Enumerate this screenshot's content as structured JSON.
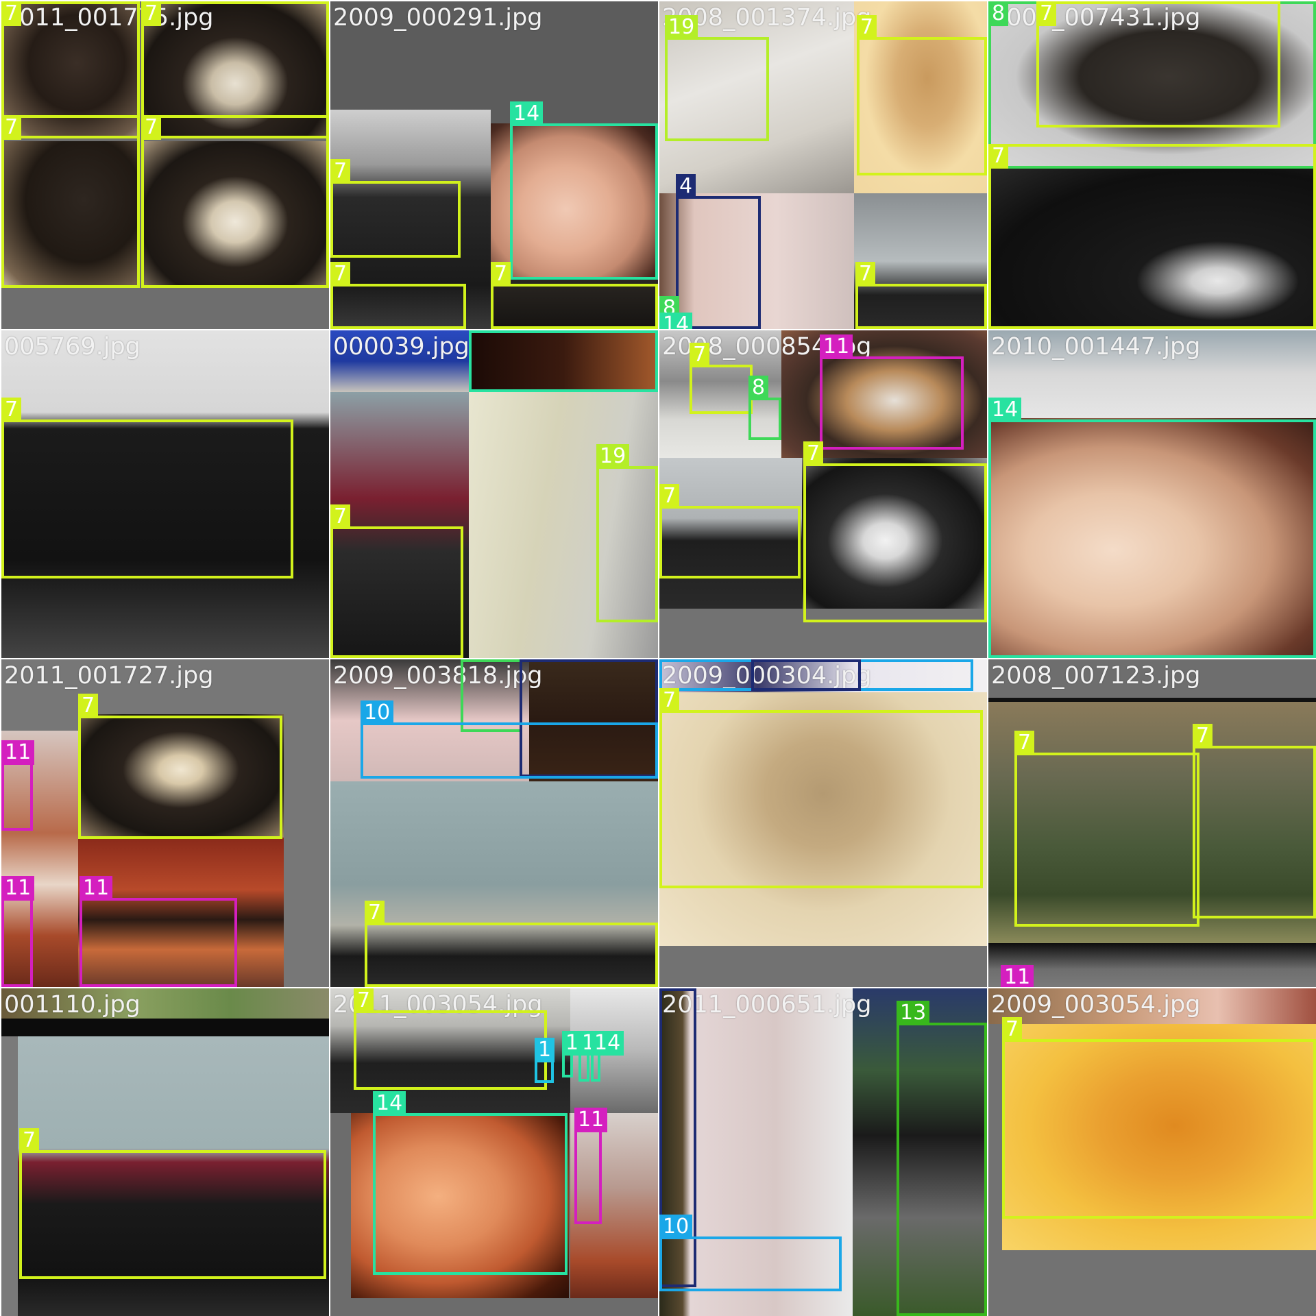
{
  "tiles": [
    {
      "id": "r0c0",
      "filename": "2011_001775.jpg"
    },
    {
      "id": "r0c1",
      "filename": "2009_000291.jpg"
    },
    {
      "id": "r0c2",
      "filename": "2008_001374.jpg"
    },
    {
      "id": "r0c3",
      "filename": "2007_007431.jpg"
    },
    {
      "id": "r1c0",
      "filename": "005769.jpg"
    },
    {
      "id": "r1c1",
      "filename": "000039.jpg"
    },
    {
      "id": "r1c2",
      "filename": "2008_000854.jpg"
    },
    {
      "id": "r1c3",
      "filename": "2010_001447.jpg"
    },
    {
      "id": "r2c0",
      "filename": "2011_001727.jpg"
    },
    {
      "id": "r2c1",
      "filename": "2009_003818.jpg"
    },
    {
      "id": "r2c2",
      "filename": "2009_000304.jpg"
    },
    {
      "id": "r2c3",
      "filename": "2008_007123.jpg"
    },
    {
      "id": "r3c0",
      "filename": "001110.jpg"
    },
    {
      "id": "r3c1",
      "filename": "2011_003054.jpg"
    },
    {
      "id": "r3c2",
      "filename": "2011_000651.jpg"
    },
    {
      "id": "r3c3",
      "filename": "2009_003054.jpg"
    }
  ],
  "class_colors": {
    "1": "#1fc3e3",
    "4": "#1d2b73",
    "7": "#d2f21c",
    "8": "#3ed858",
    "10": "#1aa7e8",
    "11": "#d41fbf",
    "13": "#38b81c",
    "14": "#27e2a0",
    "19": "#b4ee28"
  },
  "detections": {
    "r0c0": [
      "7",
      "7",
      "7",
      "7"
    ],
    "r0c1": [
      "7",
      "14",
      "7",
      "7"
    ],
    "r0c2": [
      "19",
      "7",
      "4",
      "7",
      "8",
      "14"
    ],
    "r0c3": [
      "8",
      "7",
      "7"
    ],
    "r1c0": [
      "7"
    ],
    "r1c1": [
      "14",
      "19",
      "7"
    ],
    "r1c2": [
      "7",
      "8",
      "11",
      "7",
      "7"
    ],
    "r1c3": [
      "14"
    ],
    "r2c0": [
      "7",
      "11",
      "11",
      "11"
    ],
    "r2c1": [
      "8",
      "4",
      "10",
      "7"
    ],
    "r2c2": [
      "10",
      "4",
      "7"
    ],
    "r2c3": [
      "7",
      "7",
      "11"
    ],
    "r3c0": [
      "7"
    ],
    "r3c1": [
      "7",
      "14",
      "1",
      "14",
      "14",
      "14",
      "11"
    ],
    "r3c2": [
      "4",
      "10",
      "13"
    ],
    "r3c3": [
      "7"
    ]
  }
}
